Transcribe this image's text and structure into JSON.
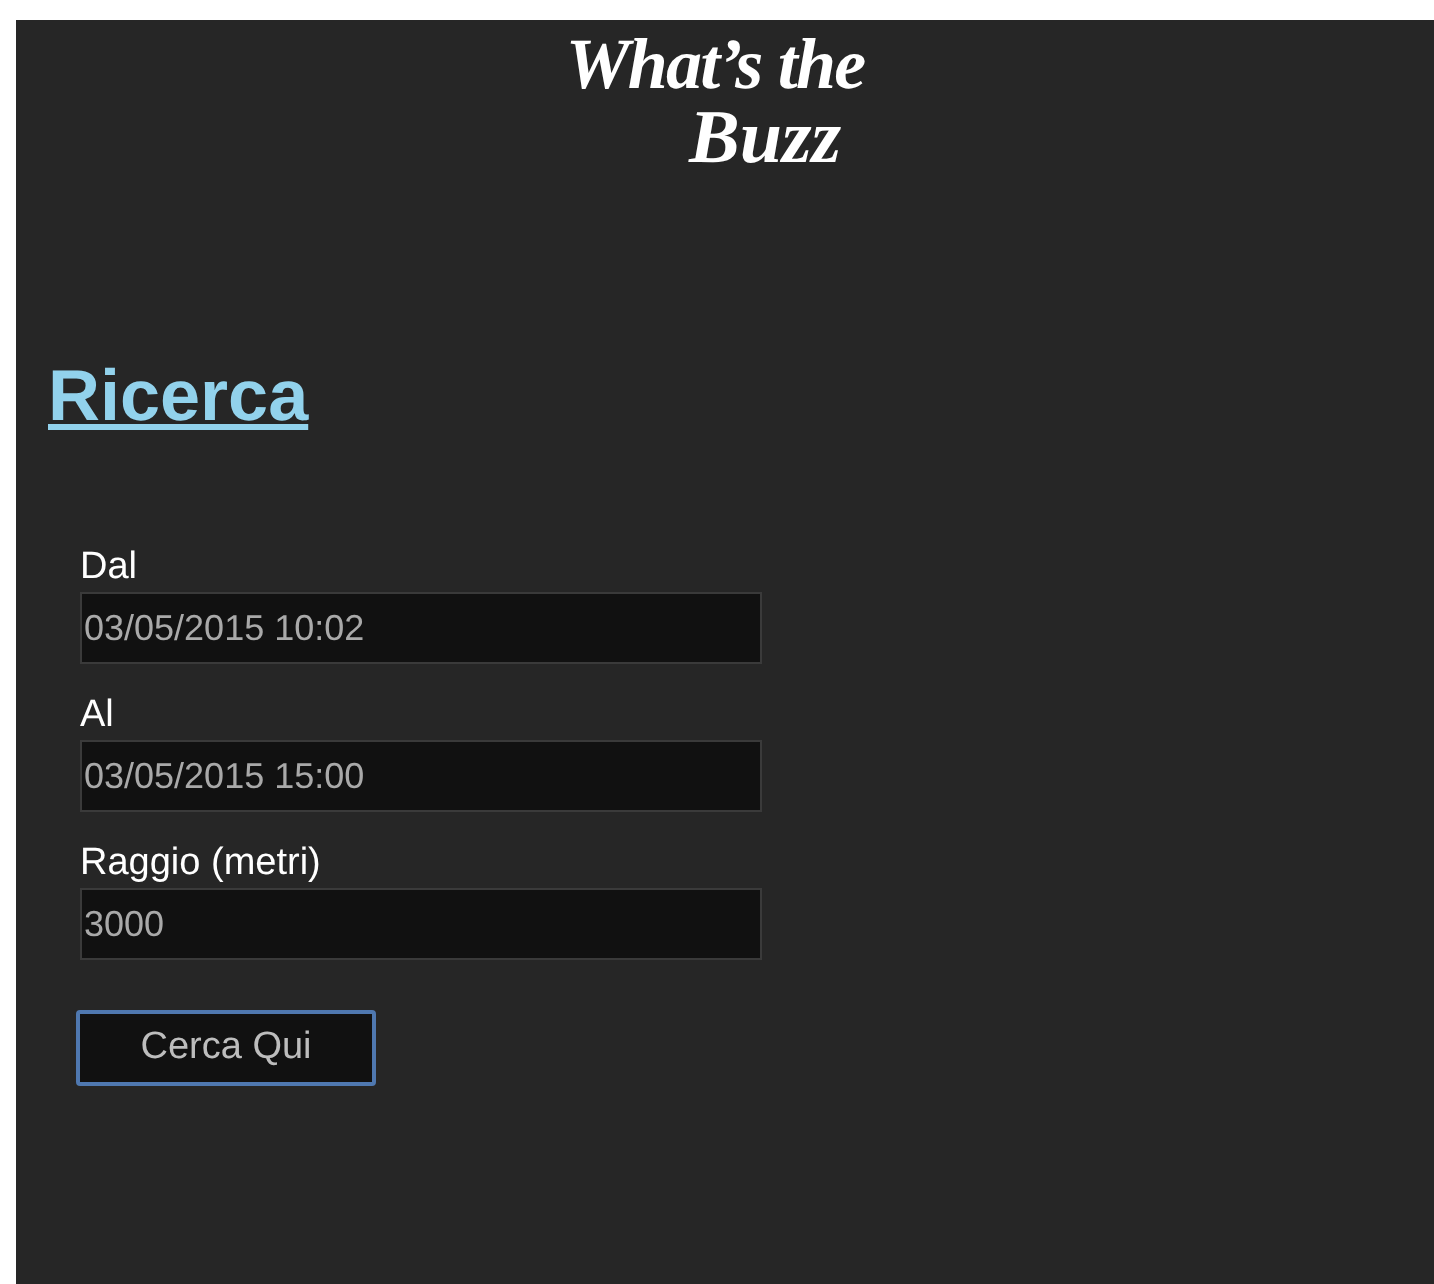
{
  "logo": {
    "line_1": "What’s the",
    "line_2": "Buzz"
  },
  "heading": "Ricerca",
  "fields": [
    {
      "label": "Dal",
      "value": "03/05/2015 10:02"
    },
    {
      "label": "Al",
      "value": "03/05/2015 15:00"
    },
    {
      "label": "Raggio (metri)",
      "value": "3000"
    }
  ],
  "button": "Cerca Qui"
}
